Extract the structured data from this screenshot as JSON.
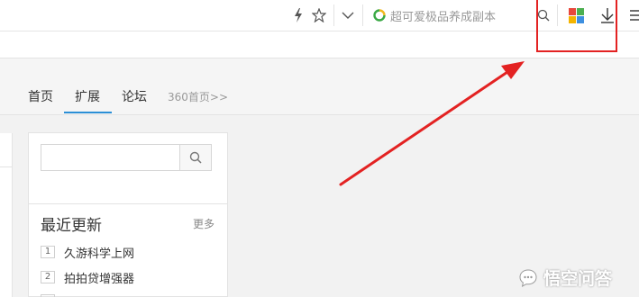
{
  "toolbar": {
    "lightning_icon": "lightning-icon",
    "star_icon": "star-icon",
    "dropdown_icon": "chevron-down-icon",
    "search_hint": "超可爱极品养成副本",
    "search_icon": "search-icon",
    "apps_icon": "app-grid-icon",
    "download_icon": "download-icon",
    "menu_icon": "menu-icon"
  },
  "nav": {
    "items": [
      {
        "label": "首页"
      },
      {
        "label": "扩展"
      },
      {
        "label": "论坛"
      },
      {
        "label": "360首页>>"
      }
    ],
    "active_index": 1
  },
  "side_panel": {
    "search_placeholder": "",
    "section_title": "最近更新",
    "more_label": "更多",
    "items": [
      {
        "rank": "1",
        "name": "久游科学上网"
      },
      {
        "rank": "2",
        "name": "拍拍贷增强器"
      }
    ]
  },
  "watermark": {
    "text": "悟空问答"
  },
  "colors": {
    "accent": "#2b8fd6",
    "annotation": "#e32222",
    "ring_green": "#3aa845",
    "ring_yellow": "#f2b81e"
  }
}
